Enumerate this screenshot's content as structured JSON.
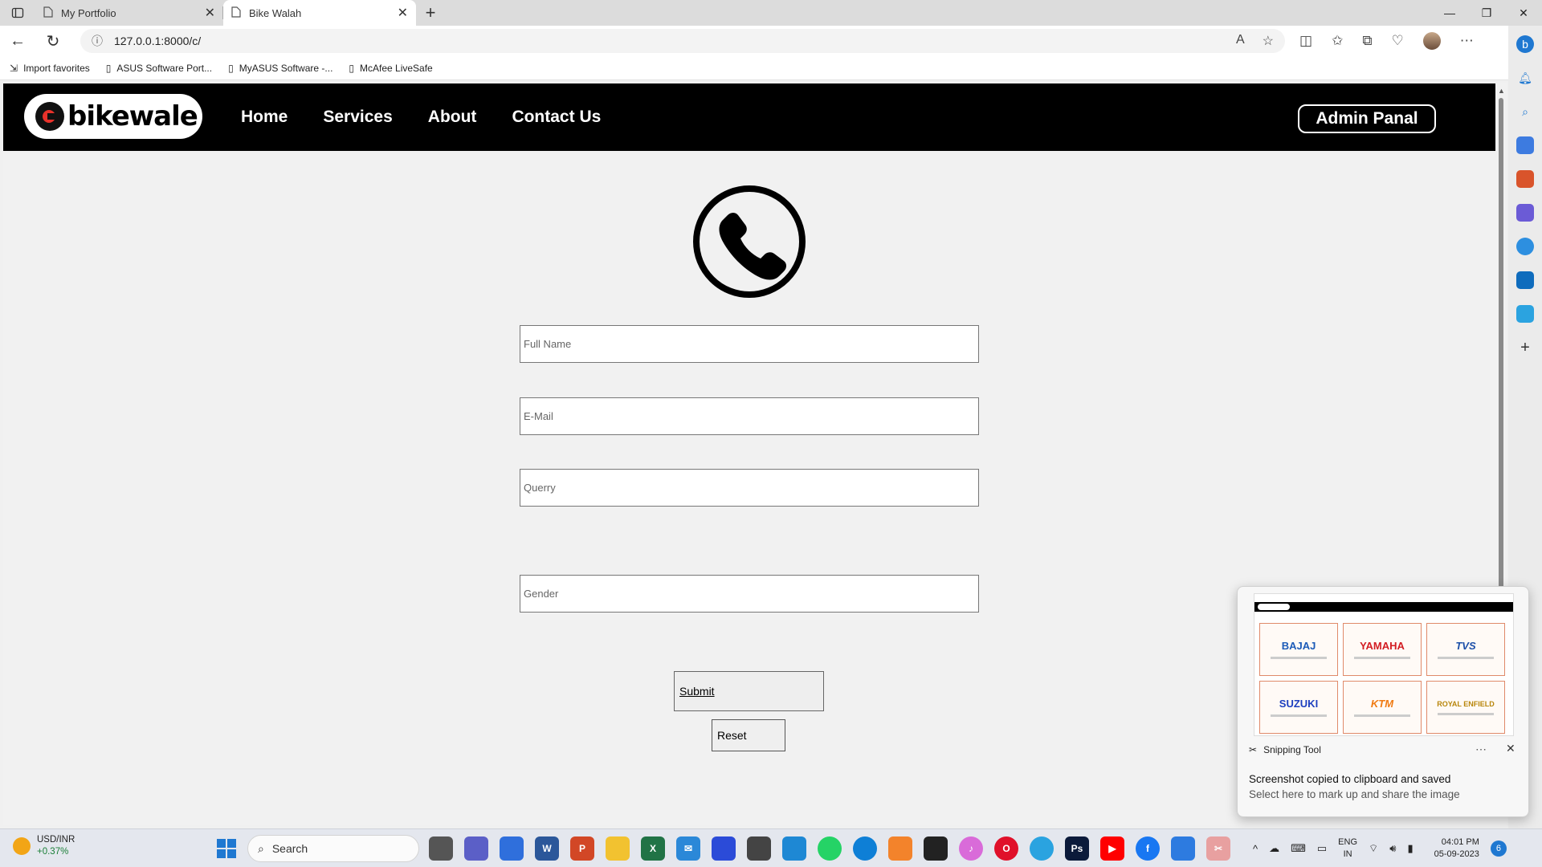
{
  "browser": {
    "tabs": [
      {
        "title": "My Portfolio",
        "active": false
      },
      {
        "title": "Bike Walah",
        "active": true
      }
    ],
    "address": "127.0.0.1:8000/c/",
    "favorites": [
      {
        "label": "Import favorites",
        "icon": "import-icon"
      },
      {
        "label": "ASUS Software Port...",
        "icon": "page-icon"
      },
      {
        "label": "MyASUS Software -...",
        "icon": "page-icon"
      },
      {
        "label": "McAfee LiveSafe",
        "icon": "page-icon"
      }
    ]
  },
  "site": {
    "logo_text": "bikewale",
    "nav": [
      {
        "label": "Home"
      },
      {
        "label": "Services"
      },
      {
        "label": "About"
      },
      {
        "label": "Contact Us"
      }
    ],
    "admin_label": "Admin Panal"
  },
  "form": {
    "full_name_placeholder": "Full Name",
    "email_placeholder": "E-Mail",
    "query_placeholder": "Querry",
    "gender_placeholder": "Gender",
    "submit_label": "Submit",
    "reset_label": "Reset"
  },
  "toast": {
    "app_name": "Snipping Tool",
    "title": "Screenshot copied to clipboard and saved",
    "subtitle": "Select here to mark up and share the image",
    "brands": [
      "BAJAJ",
      "YAMAHA",
      "TVS",
      "SUZUKI",
      "KTM",
      "ROYAL ENFIELD"
    ]
  },
  "taskbar": {
    "ticker": "USD/INR",
    "change": "+0.37%",
    "search_placeholder": "Search",
    "lang_line1": "ENG",
    "lang_line2": "IN",
    "time": "04:01 PM",
    "date": "05-09-2023",
    "notification_count": "6"
  },
  "colors": {
    "nav_bg": "#000000",
    "page_bg": "#f1f1f1",
    "accent": "#1f78d1"
  }
}
